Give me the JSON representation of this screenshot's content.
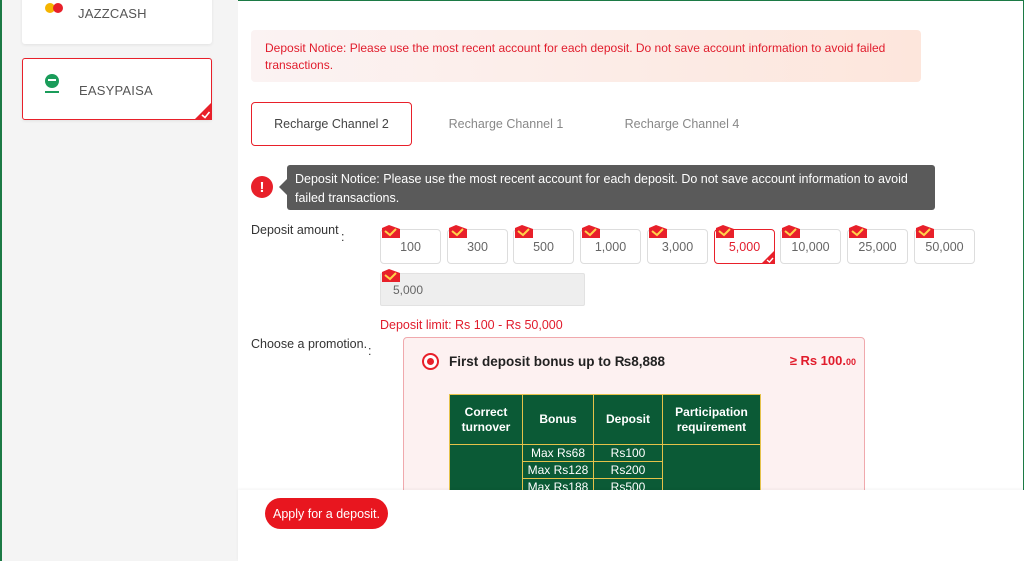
{
  "sidebar": {
    "methods": [
      {
        "label": "JAZZCASH",
        "logo_text": "JazzCash",
        "selected": false
      },
      {
        "label": "EASYPAISA",
        "logo_text": "easypaisa",
        "selected": true
      }
    ]
  },
  "notice": {
    "text": "Deposit Notice: Please use the most recent account for each deposit. Do not save account information to avoid failed transactions."
  },
  "tabs": [
    {
      "label": "Recharge Channel 2",
      "active": true
    },
    {
      "label": "Recharge Channel 1",
      "active": false
    },
    {
      "label": "Recharge Channel 4",
      "active": false
    }
  ],
  "tooltip": {
    "text": "Deposit Notice: Please use the most recent account for each deposit. Do not save account information to avoid failed transactions."
  },
  "deposit": {
    "label": "Deposit amount",
    "colon": ":",
    "amounts": [
      "100",
      "300",
      "500",
      "1,000",
      "3,000",
      "5,000",
      "10,000",
      "25,000",
      "50,000"
    ],
    "selected": "5,000",
    "input_value": "5,000",
    "limit_text": "Deposit limit:  Rs  100 - Rs  50,000"
  },
  "promotion": {
    "label": "Choose a promotion.",
    "colon": ":",
    "title": "First deposit bonus up to ₨8,888",
    "min_prefix": "≥ Rs  100.",
    "min_suffix": "00",
    "table": {
      "headers": [
        "Correct turnover",
        "Bonus",
        "Deposit",
        "Participation requirement"
      ],
      "rows": [
        {
          "bonus": "Max Rs68",
          "deposit": "Rs100"
        },
        {
          "bonus": "Max Rs128",
          "deposit": "Rs200"
        },
        {
          "bonus": "Max Rs188",
          "deposit": "Rs500"
        }
      ]
    }
  },
  "actions": {
    "apply_label": "Apply for a deposit."
  },
  "colors": {
    "accent": "#e8202a",
    "table_bg": "#0b5a36",
    "table_border": "#e5c24a",
    "tooltip_bg": "#5a5a5a"
  }
}
